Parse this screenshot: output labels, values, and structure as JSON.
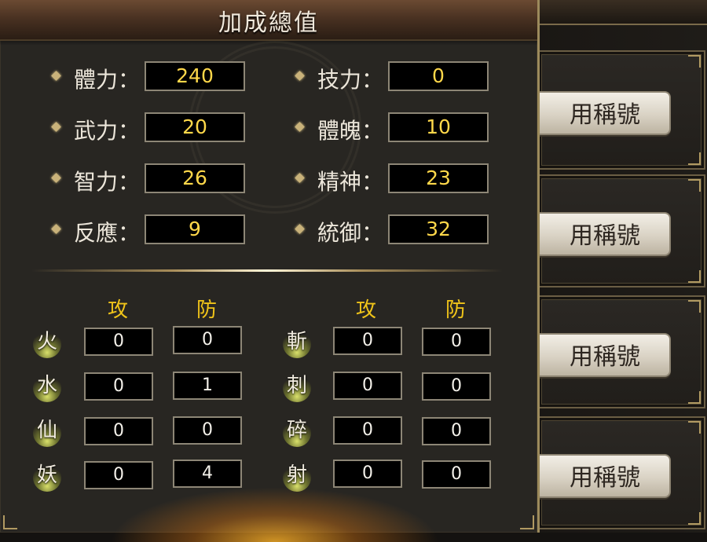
{
  "panel": {
    "title": "加成總值"
  },
  "stats": [
    {
      "label": "體力：",
      "value": "240"
    },
    {
      "label": "技力：",
      "value": "0"
    },
    {
      "label": "武力：",
      "value": "20"
    },
    {
      "label": "體魄：",
      "value": "10"
    },
    {
      "label": "智力：",
      "value": "26"
    },
    {
      "label": "精神：",
      "value": "23"
    },
    {
      "label": "反應：",
      "value": "9"
    },
    {
      "label": "統御：",
      "value": "32"
    }
  ],
  "resist_headers": {
    "attack": "攻",
    "defense": "防"
  },
  "elements_left": [
    {
      "name": "火",
      "attack": "0",
      "defense": "0"
    },
    {
      "name": "水",
      "attack": "0",
      "defense": "1"
    },
    {
      "name": "仙",
      "attack": "0",
      "defense": "0"
    },
    {
      "name": "妖",
      "attack": "0",
      "defense": "4"
    }
  ],
  "elements_right": [
    {
      "name": "斬",
      "attack": "0",
      "defense": "0"
    },
    {
      "name": "刺",
      "attack": "0",
      "defense": "0"
    },
    {
      "name": "碎",
      "attack": "0",
      "defense": "0"
    },
    {
      "name": "射",
      "attack": "0",
      "defense": "0"
    }
  ],
  "title_cards": [
    {
      "button_label": "用稱號"
    },
    {
      "button_label": "用稱號"
    },
    {
      "button_label": "用稱號"
    },
    {
      "button_label": "用稱號"
    }
  ],
  "colors": {
    "value_text": "#ffd84a",
    "header_text": "#f0c419",
    "frame_gold": "#9c8a5c"
  }
}
